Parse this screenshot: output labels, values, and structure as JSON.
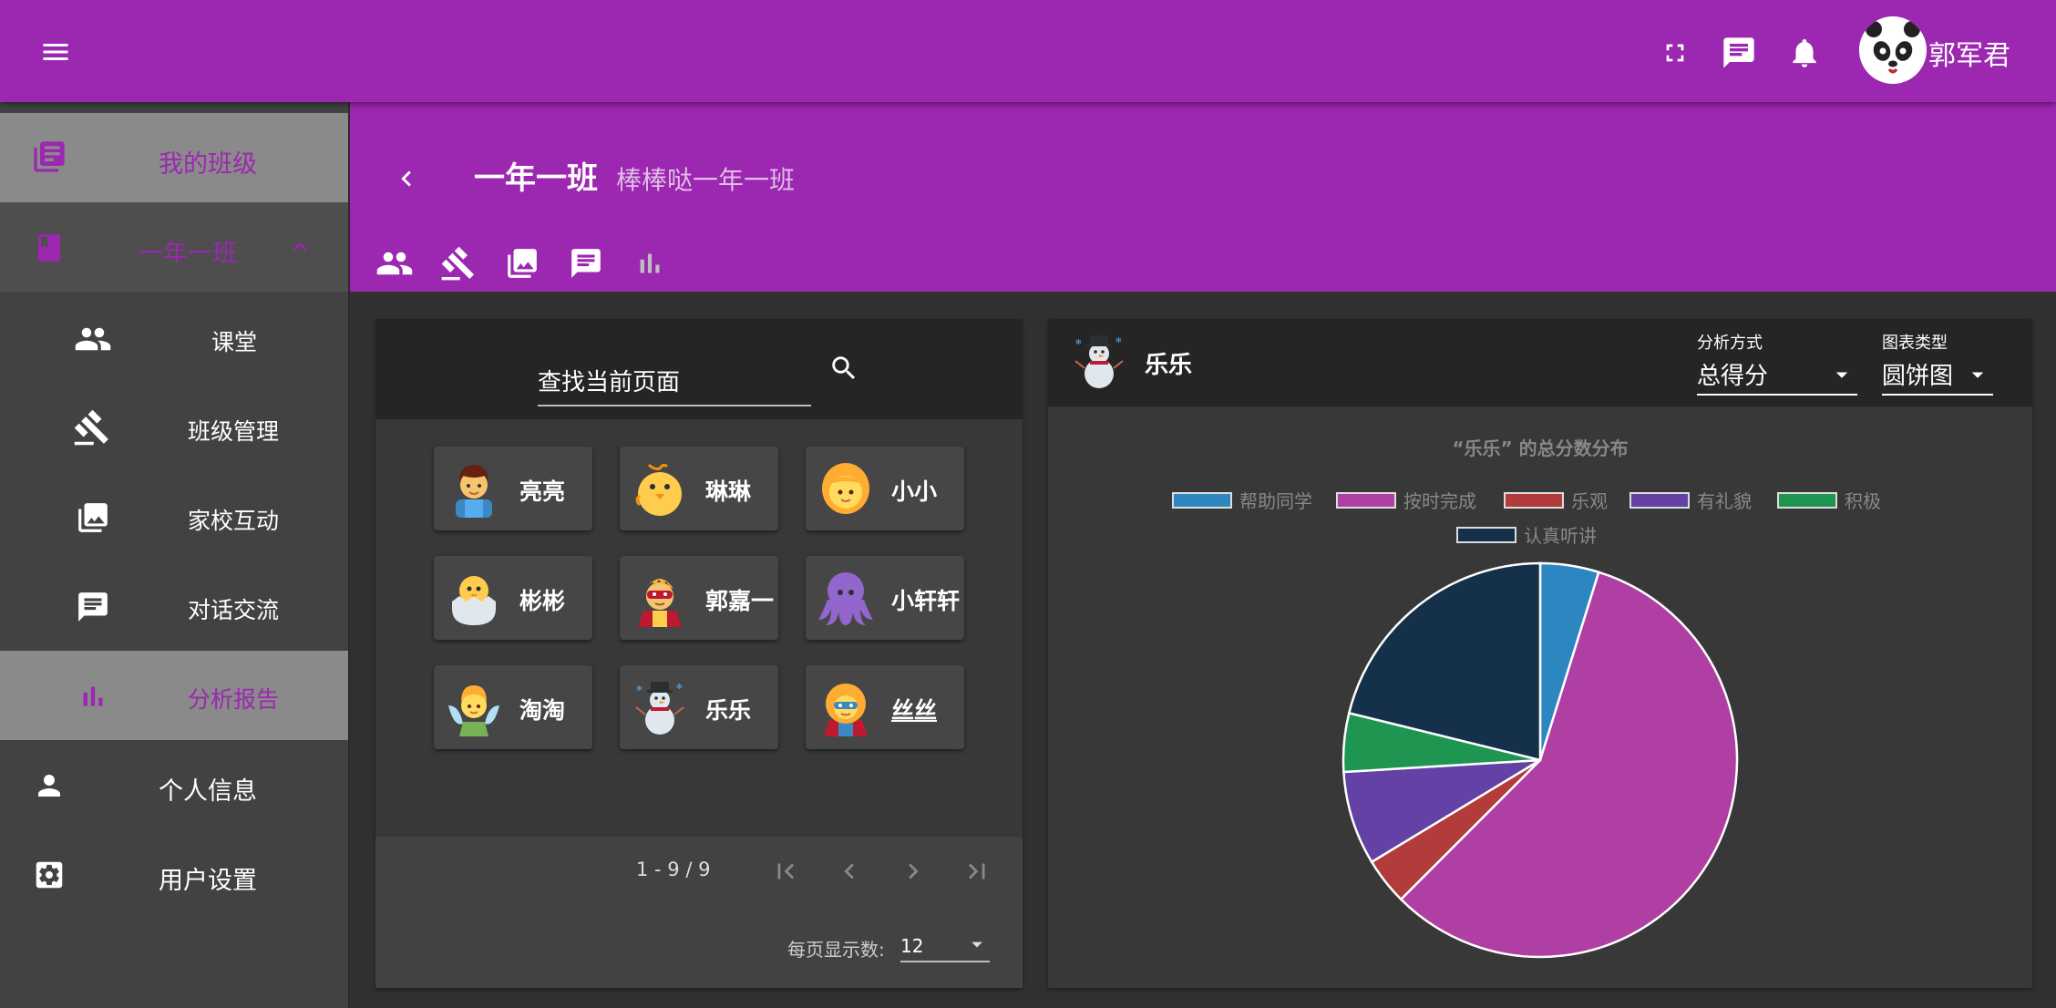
{
  "topbar": {
    "user_name": "郭军君",
    "menu_icon": "menu-icon",
    "fullscreen_icon": "fullscreen-icon",
    "chat_icon": "chat-icon",
    "bell_icon": "bell-icon"
  },
  "sidebar": {
    "my_class": "我的班级",
    "class_name": "一年一班",
    "sub_items": [
      {
        "label": "课堂",
        "icon": "people-icon"
      },
      {
        "label": "班级管理",
        "icon": "gavel-icon"
      },
      {
        "label": "家校互动",
        "icon": "photo-library-icon"
      },
      {
        "label": "对话交流",
        "icon": "chat-icon"
      },
      {
        "label": "分析报告",
        "icon": "bar-chart-icon"
      }
    ],
    "profile": "个人信息",
    "settings": "用户设置"
  },
  "header": {
    "title": "一年一班",
    "subtitle": "棒棒哒一年一班"
  },
  "search": {
    "placeholder": "查找当前页面"
  },
  "students": [
    {
      "name": "亮亮",
      "icon": "boy-icon"
    },
    {
      "name": "琳琳",
      "icon": "chick-icon"
    },
    {
      "name": "小小",
      "icon": "girl-icon"
    },
    {
      "name": "彬彬",
      "icon": "hatching-chick-icon"
    },
    {
      "name": "郭嘉一",
      "icon": "superhero-icon"
    },
    {
      "name": "小轩轩",
      "icon": "octopus-icon"
    },
    {
      "name": "淘淘",
      "icon": "fairy-icon"
    },
    {
      "name": "乐乐",
      "icon": "snowman-icon"
    },
    {
      "name": "丝丝",
      "icon": "superheroine-icon"
    }
  ],
  "pagination": {
    "range": "1 - 9 / 9",
    "per_page_label": "每页显示数:",
    "per_page_value": "12"
  },
  "analysis": {
    "student_name": "乐乐",
    "method_label": "分析方式",
    "method_value": "总得分",
    "chart_type_label": "图表类型",
    "chart_type_value": "圆饼图"
  },
  "colors": {
    "primary": "#9c27b0",
    "active_nav_text": "#9c27b0"
  },
  "chart_data": {
    "type": "pie",
    "title": "“乐乐” 的总分数分布",
    "legend_position": "top",
    "series": [
      {
        "name": "帮助同学",
        "value": 5,
        "color": "#2e86c1"
      },
      {
        "name": "按时完成",
        "value": 60,
        "color": "#b03fa3"
      },
      {
        "name": "乐观",
        "value": 4,
        "color": "#b23b3b"
      },
      {
        "name": "有礼貌",
        "value": 8,
        "color": "#6441a4"
      },
      {
        "name": "积极",
        "value": 5,
        "color": "#1e9652"
      },
      {
        "name": "认真听讲",
        "value": 22,
        "color": "#15304a"
      }
    ]
  }
}
